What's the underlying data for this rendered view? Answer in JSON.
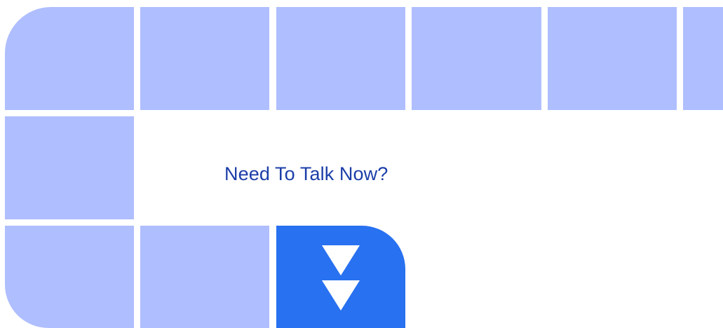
{
  "colors": {
    "tile": "#afbefe",
    "accent": "#2871f0",
    "headline": "#1b3ea8",
    "background": "#ffffff"
  },
  "hero": {
    "headline": "Need To Talk Now?"
  },
  "scroll_button": {
    "icon": "double-chevron-down-icon"
  }
}
